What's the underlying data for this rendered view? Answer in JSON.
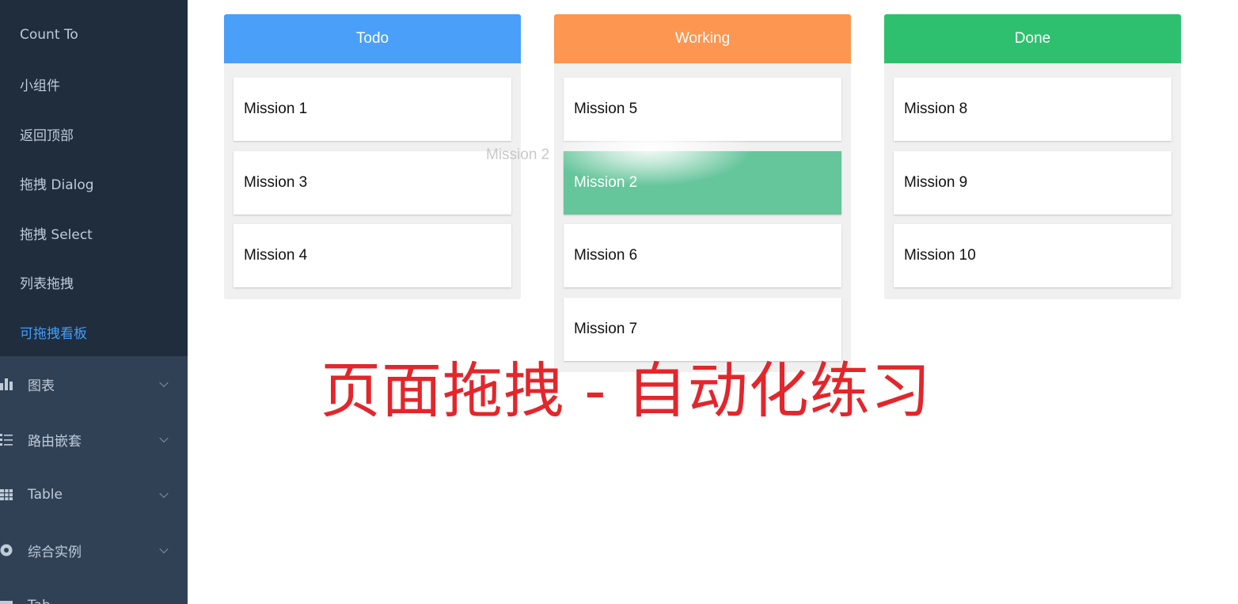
{
  "sidebar": {
    "submenu_items": [
      {
        "label": "Count To"
      },
      {
        "label": "小组件"
      },
      {
        "label": "返回顶部"
      },
      {
        "label": "拖拽 Dialog"
      },
      {
        "label": "拖拽 Select"
      },
      {
        "label": "列表拖拽"
      },
      {
        "label": "可拖拽看板",
        "active": true
      }
    ],
    "menu_items": [
      {
        "label": "图表",
        "icon": "bar-chart-icon"
      },
      {
        "label": "路由嵌套",
        "icon": "list-icon"
      },
      {
        "label": "Table",
        "icon": "table-icon"
      },
      {
        "label": "综合实例",
        "icon": "component-icon"
      },
      {
        "label": "Tab",
        "icon": "tab-icon"
      }
    ]
  },
  "boards": [
    {
      "title": "Todo",
      "color": "#4a9ff9",
      "cards": [
        "Mission 1",
        "Mission 3",
        "Mission 4"
      ]
    },
    {
      "title": "Working",
      "color": "#fc9650",
      "cards": [
        "Mission 5",
        "Mission 2",
        "Mission 6",
        "Mission 7"
      ]
    },
    {
      "title": "Done",
      "color": "#2ec06f",
      "cards": [
        "Mission 8",
        "Mission 9",
        "Mission 10"
      ]
    }
  ],
  "drag": {
    "ghost_label": "Mission 2",
    "placeholder_color": "#65c59b"
  },
  "overlay_title": "页面拖拽 - 自动化练习"
}
